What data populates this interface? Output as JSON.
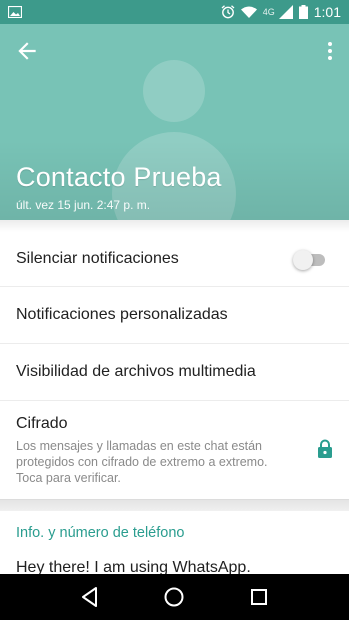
{
  "status_bar": {
    "time": "1:01",
    "network": "4G",
    "icons": [
      "image-icon",
      "alarm-icon",
      "wifi-icon",
      "signal-icon",
      "battery-icon"
    ]
  },
  "header": {
    "contact_name": "Contacto Prueba",
    "last_seen": "últ. vez 15 jun. 2:47 p. m.",
    "colors": {
      "header_bg": "#78c3b6",
      "status_bg": "#3d9a8b"
    }
  },
  "settings": {
    "mute_label": "Silenciar notificaciones",
    "mute_enabled": false,
    "custom_notifications_label": "Notificaciones personalizadas",
    "media_visibility_label": "Visibilidad de archivos multimedia",
    "encryption": {
      "title": "Cifrado",
      "description": "Los mensajes y llamadas en este chat están protegidos con cifrado de extremo a extremo. Toca para verificar."
    }
  },
  "info": {
    "section_title": "Info. y número de teléfono",
    "status_text": "Hey there! I am using WhatsApp.",
    "accent_color": "#2a9d8f"
  },
  "nav": {
    "icons": [
      "back-triangle-icon",
      "home-circle-icon",
      "recents-square-icon"
    ]
  }
}
